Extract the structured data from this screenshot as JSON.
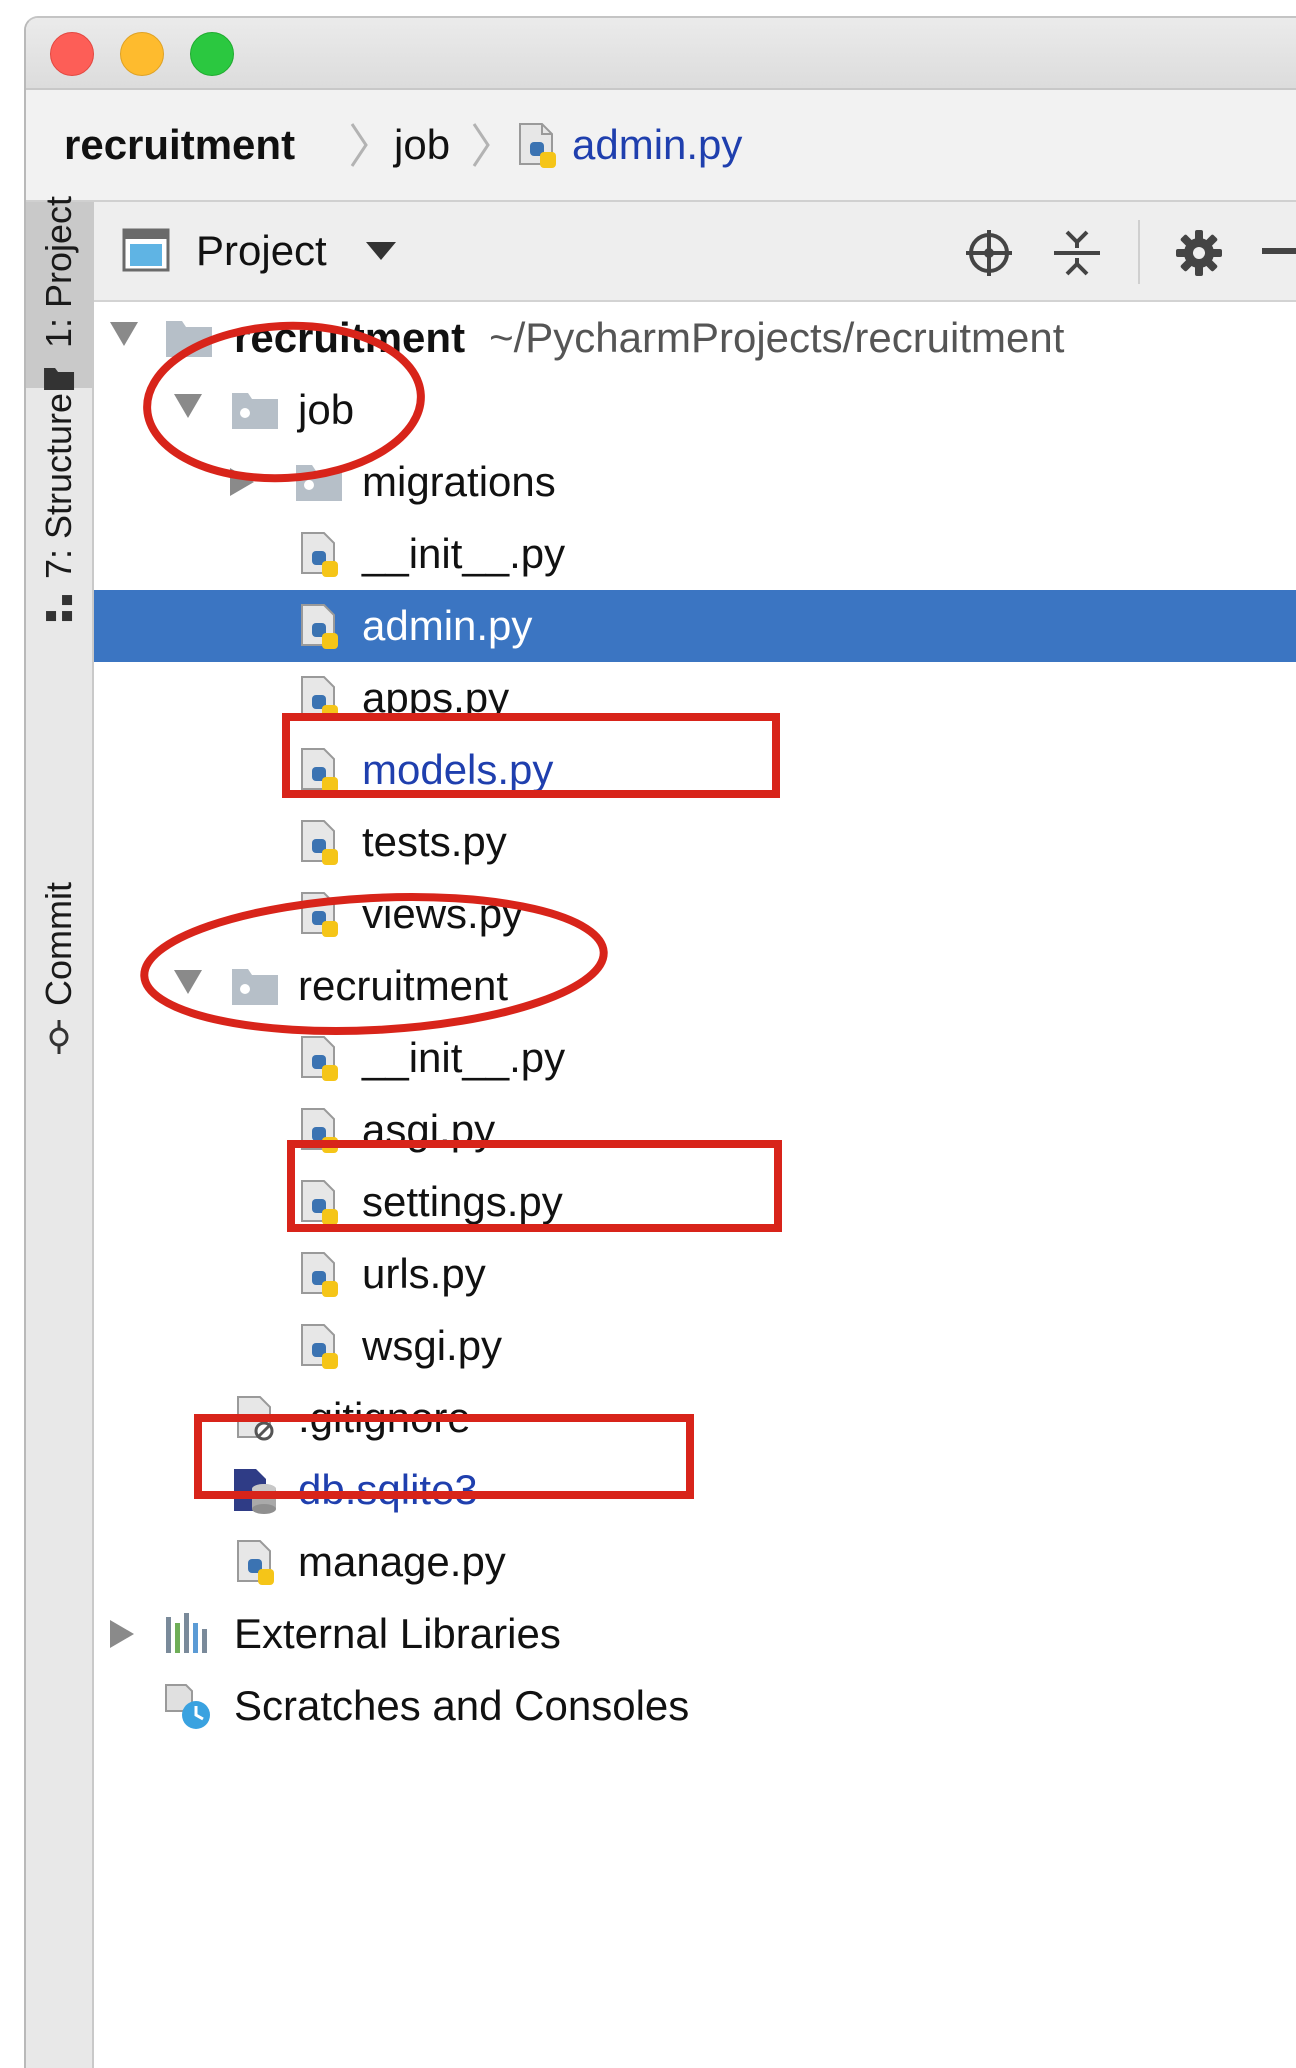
{
  "breadcrumb": {
    "project": "recruitment",
    "folder": "job",
    "file": "admin.py"
  },
  "tool_windows": {
    "project": "1: Project",
    "structure": "7: Structure",
    "commit": "Commit"
  },
  "panel": {
    "title": "Project"
  },
  "tree": {
    "root_name": "recruitment",
    "root_path": "~/PycharmProjects/recruitment",
    "job": "job",
    "migrations": "migrations",
    "job_init": "__init__.py",
    "admin": "admin.py",
    "apps": "apps.py",
    "models": "models.py",
    "tests": "tests.py",
    "views": "views.py",
    "recruitment_pkg": "recruitment",
    "rec_init": "__init__.py",
    "asgi": "asgi.py",
    "settings": "settings.py",
    "urls": "urls.py",
    "wsgi": "wsgi.py",
    "gitignore": ".gitignore",
    "db": "db.sqlite3",
    "manage": "manage.py",
    "external": "External Libraries",
    "scratches": "Scratches and Consoles"
  },
  "colors": {
    "selection": "#3b75c2",
    "annotation": "#d8241a",
    "link": "#1f3fae"
  }
}
